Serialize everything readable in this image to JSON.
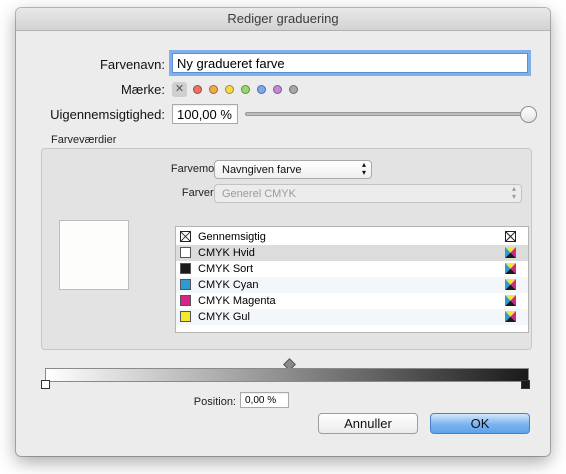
{
  "dialog": {
    "title": "Rediger graduering"
  },
  "form": {
    "name_label": "Farvenavn:",
    "name_value": "Ny gradueret farve",
    "tag_label": "Mærke:",
    "tag_none_glyph": "✕",
    "tag_colors": [
      "#e8736c",
      "#f0a94b",
      "#f3d94c",
      "#9bd66a",
      "#7fa6ee",
      "#c08ad9",
      "#a7a7a7"
    ],
    "opacity_label": "Uigennemsigtighed:",
    "opacity_value": "100,00 %",
    "opacity_level": 1.0
  },
  "color_values": {
    "group_label": "Farveværdier",
    "model_label": "Farvemodel:",
    "model_value": "Navngiven farve",
    "space_label": "Farverum:",
    "space_value": "Generel CMYK",
    "swatches": [
      {
        "name": "Gennemsigtig",
        "color": "none"
      },
      {
        "name": "CMYK Hvid",
        "color": "#ffffff"
      },
      {
        "name": "CMYK Sort",
        "color": "#1a1a1a"
      },
      {
        "name": "CMYK Cyan",
        "color": "#2b9bd6"
      },
      {
        "name": "CMYK Magenta",
        "color": "#d6248a"
      },
      {
        "name": "CMYK Gul",
        "color": "#f4ea2c"
      }
    ],
    "selected_index": 1
  },
  "gradient": {
    "start_color": "#ffffff",
    "end_color": "#1a1a1a",
    "position_label": "Position:",
    "position_value": "0,00 %"
  },
  "buttons": {
    "cancel": "Annuller",
    "ok": "OK"
  }
}
